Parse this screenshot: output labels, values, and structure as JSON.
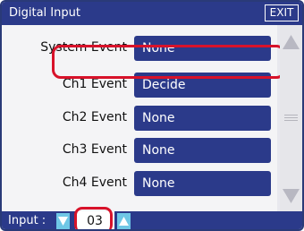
{
  "window": {
    "title": "Digital Input",
    "exit_label": "EXIT"
  },
  "rows": [
    {
      "label": "System Event",
      "value": "None"
    },
    {
      "label": "Ch1 Event",
      "value": "Decide"
    },
    {
      "label": "Ch2 Event",
      "value": "None"
    },
    {
      "label": "Ch3 Event",
      "value": "None"
    },
    {
      "label": "Ch4 Event",
      "value": "None"
    }
  ],
  "highlighted_row": "Ch1 Event",
  "input": {
    "label": "Input :",
    "value": "03"
  },
  "icons": {
    "decrement": "triangle-down-icon",
    "increment": "triangle-up-icon",
    "scroll_up": "scroll-up-arrow-icon",
    "scroll_down": "scroll-down-arrow-icon"
  },
  "colors": {
    "title_bar": "#2b3a8a",
    "field": "#2b3a8a",
    "arrow_button": "#6fc7e6",
    "highlight": "#d8122a"
  }
}
